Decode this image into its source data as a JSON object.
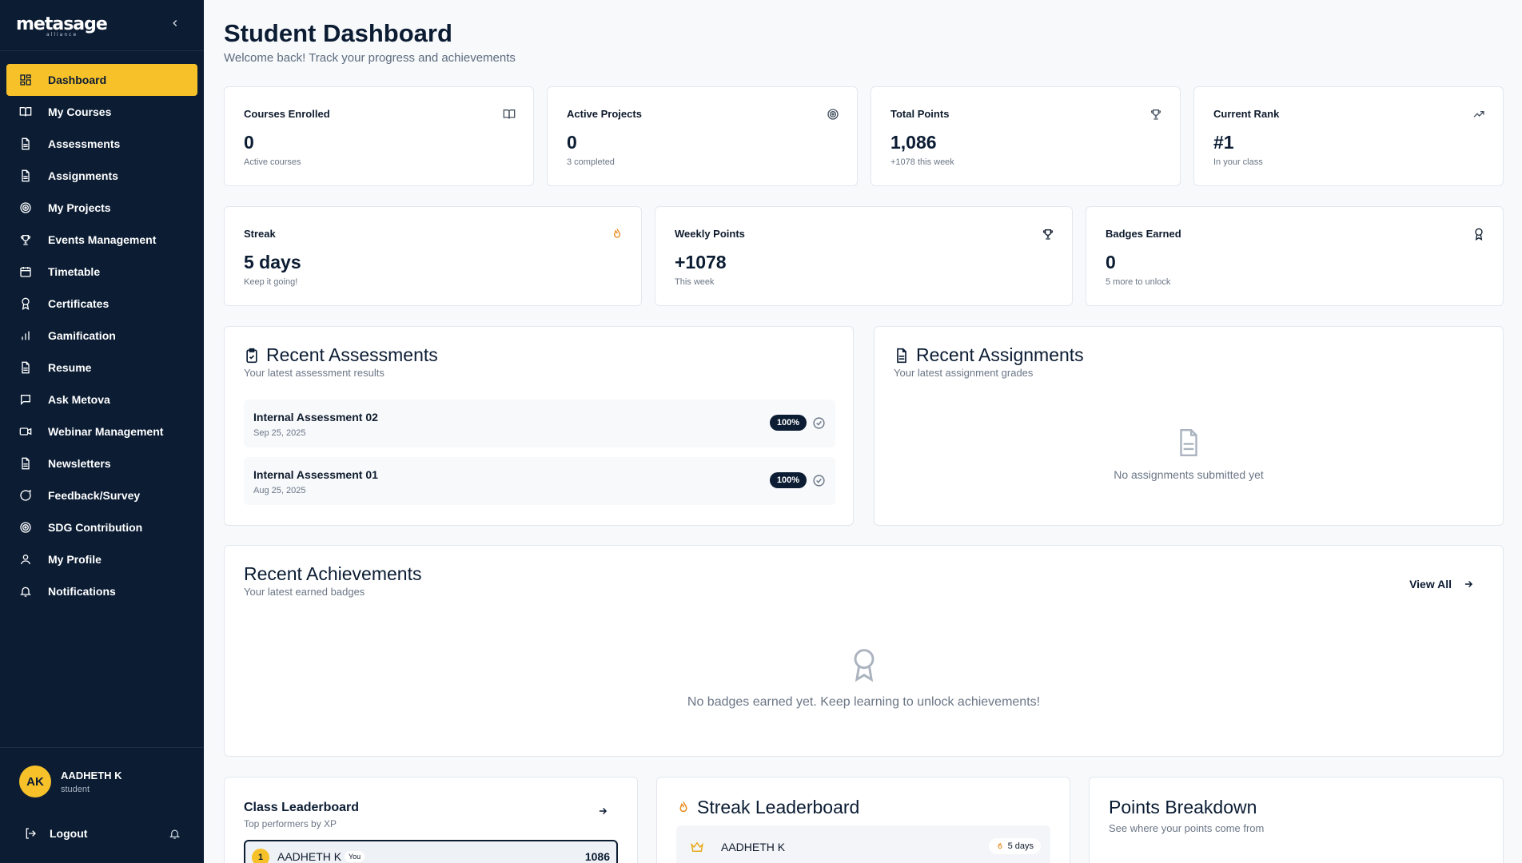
{
  "brand": {
    "logo": "metasage",
    "tagline": "alliance"
  },
  "nav": [
    {
      "label": "Dashboard",
      "icon": "dashboard-icon",
      "active": true
    },
    {
      "label": "My Courses",
      "icon": "book-icon"
    },
    {
      "label": "Assessments",
      "icon": "document-icon"
    },
    {
      "label": "Assignments",
      "icon": "document-icon"
    },
    {
      "label": "My Projects",
      "icon": "target-icon"
    },
    {
      "label": "Events Management",
      "icon": "trophy-icon"
    },
    {
      "label": "Timetable",
      "icon": "calendar-icon"
    },
    {
      "label": "Certificates",
      "icon": "award-icon"
    },
    {
      "label": "Gamification",
      "icon": "bar-chart-icon"
    },
    {
      "label": "Resume",
      "icon": "document-icon"
    },
    {
      "label": "Ask Metova",
      "icon": "chat-icon"
    },
    {
      "label": "Webinar Management",
      "icon": "video-icon"
    },
    {
      "label": "Newsletters",
      "icon": "document-icon"
    },
    {
      "label": "Feedback/Survey",
      "icon": "chat-bubble-icon"
    },
    {
      "label": "SDG Contribution",
      "icon": "target-icon"
    },
    {
      "label": "My Profile",
      "icon": "user-icon"
    },
    {
      "label": "Notifications",
      "icon": "bell-icon"
    }
  ],
  "user": {
    "initials": "AK",
    "name": "AADHETH K",
    "role": "student",
    "logout": "Logout"
  },
  "header": {
    "title": "Student Dashboard",
    "subtitle": "Welcome back! Track your progress and achievements"
  },
  "stats_row1": [
    {
      "label": "Courses Enrolled",
      "value": "0",
      "sub": "Active courses",
      "icon": "book-icon"
    },
    {
      "label": "Active Projects",
      "value": "0",
      "sub": "3 completed",
      "icon": "target-icon"
    },
    {
      "label": "Total Points",
      "value": "1,086",
      "sub": "+1078 this week",
      "icon": "trophy-icon"
    },
    {
      "label": "Current Rank",
      "value": "#1",
      "sub": "In your class",
      "icon": "trending-up-icon"
    }
  ],
  "stats_row2": [
    {
      "label": "Streak",
      "value": "5 days",
      "sub": "Keep it going!",
      "icon": "flame-icon"
    },
    {
      "label": "Weekly Points",
      "value": "+1078",
      "sub": "This week",
      "icon": "trophy-icon"
    },
    {
      "label": "Badges Earned",
      "value": "0",
      "sub": "5 more to unlock",
      "icon": "award-icon"
    }
  ],
  "recent_assessments": {
    "title": "Recent Assessments",
    "subtitle": "Your latest assessment results",
    "items": [
      {
        "name": "Internal Assessment 02",
        "date": "Sep 25, 2025",
        "score": "100%"
      },
      {
        "name": "Internal Assessment 01",
        "date": "Aug 25, 2025",
        "score": "100%"
      }
    ]
  },
  "recent_assignments": {
    "title": "Recent Assignments",
    "subtitle": "Your latest assignment grades",
    "empty": "No assignments submitted yet"
  },
  "recent_achievements": {
    "title": "Recent Achievements",
    "subtitle": "Your latest earned badges",
    "view_all": "View All",
    "empty": "No badges earned yet. Keep learning to unlock achievements!"
  },
  "class_leaderboard": {
    "title": "Class Leaderboard",
    "subtitle": "Top performers by XP",
    "entry": {
      "rank": "1",
      "name": "AADHETH K",
      "tag": "You",
      "points": "1086"
    }
  },
  "streak_leaderboard": {
    "title": "Streak Leaderboard",
    "entry": {
      "name": "AADHETH K",
      "streak": "5 days"
    }
  },
  "points_breakdown": {
    "title": "Points Breakdown",
    "subtitle": "See where your points come from"
  },
  "colors": {
    "sidebar": "#0b1c33",
    "accent": "#f7c12a",
    "streak": "#e8891a"
  }
}
